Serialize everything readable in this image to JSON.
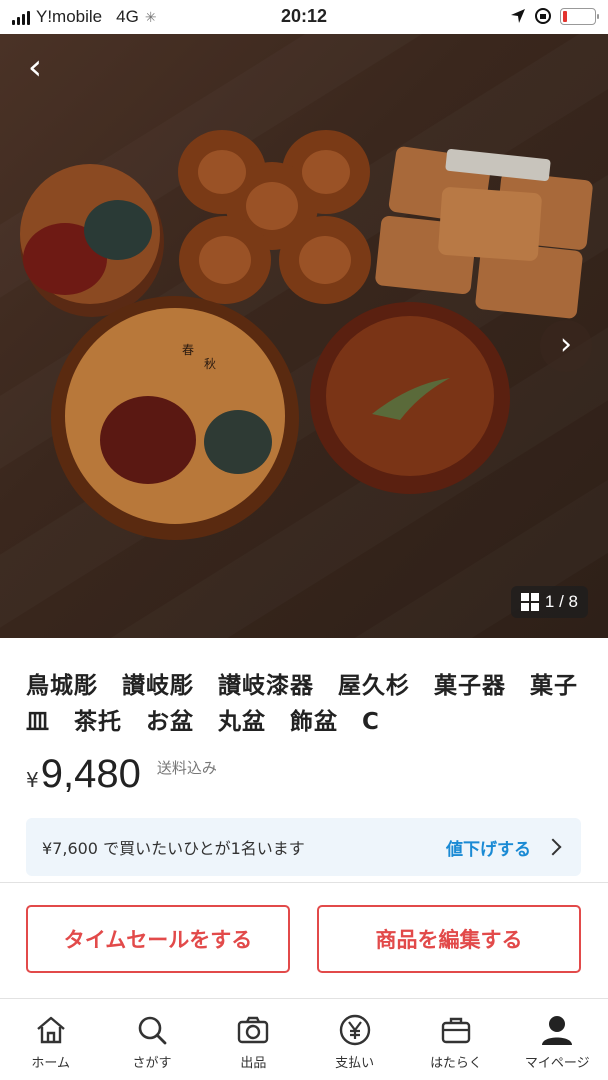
{
  "status_bar": {
    "carrier": "Y!mobile",
    "network": "4G",
    "time": "20:12"
  },
  "gallery": {
    "counter": "1 / 8",
    "current_image": 1,
    "total_images": 8
  },
  "listing": {
    "title": "鳥城彫　讃岐彫　讃岐漆器　屋久杉　菓子器　菓子皿　茶托　お盆　丸盆　飾盆　C",
    "currency_symbol": "¥",
    "price": "9,480",
    "shipping_label": "送料込み"
  },
  "offer": {
    "text": "¥7,600 で買いたいひとが1名います",
    "link_label": "値下げする"
  },
  "actions": {
    "time_sale_label": "タイムセールをする",
    "edit_label": "商品を編集する"
  },
  "tabbar": {
    "items": [
      {
        "label": "ホーム",
        "icon": "home-icon"
      },
      {
        "label": "さがす",
        "icon": "search-icon"
      },
      {
        "label": "出品",
        "icon": "camera-icon"
      },
      {
        "label": "支払い",
        "icon": "yen-icon"
      },
      {
        "label": "はたらく",
        "icon": "briefcase-icon"
      },
      {
        "label": "マイページ",
        "icon": "person-icon"
      }
    ]
  },
  "colors": {
    "accent_red": "#e24a4a",
    "link_blue": "#1a8ad4",
    "offer_bg": "#eef5fb"
  }
}
